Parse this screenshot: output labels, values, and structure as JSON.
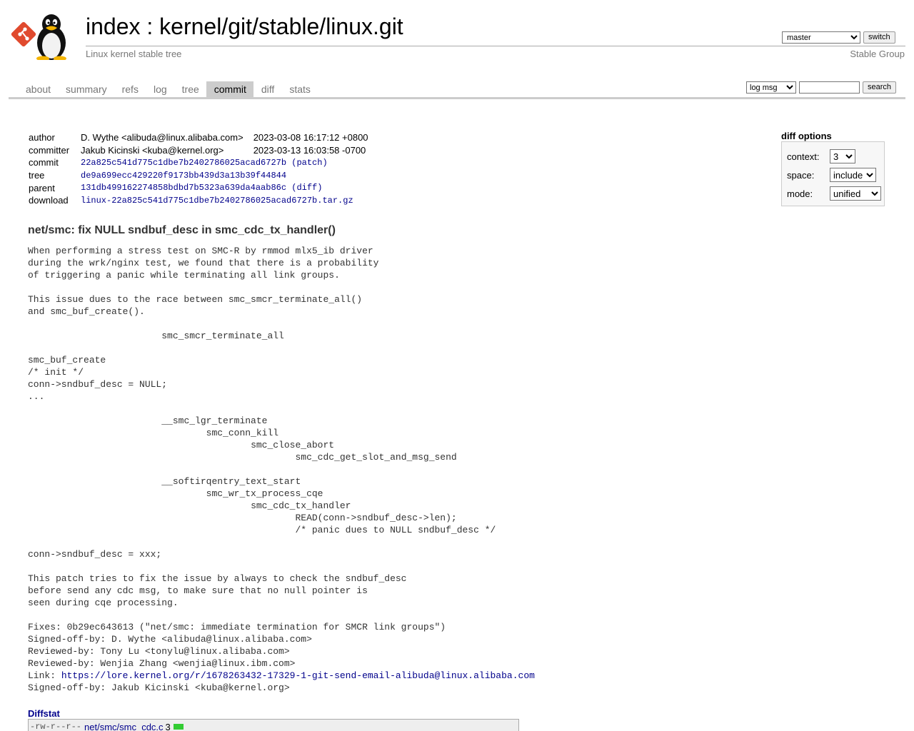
{
  "header": {
    "title_index": "index",
    "title_sep": " : ",
    "title_repo": "kernel/git/stable/linux.git",
    "description": "Linux kernel stable tree",
    "owner": "Stable Group",
    "branch_selected": "master",
    "switch_label": "switch"
  },
  "tabs": [
    {
      "label": "about",
      "active": false
    },
    {
      "label": "summary",
      "active": false
    },
    {
      "label": "refs",
      "active": false
    },
    {
      "label": "log",
      "active": false
    },
    {
      "label": "tree",
      "active": false
    },
    {
      "label": "commit",
      "active": true
    },
    {
      "label": "diff",
      "active": false
    },
    {
      "label": "stats",
      "active": false
    }
  ],
  "search": {
    "mode_selected": "log msg",
    "query": "",
    "button_label": "search"
  },
  "commit_info": {
    "author_label": "author",
    "author": "D. Wythe <alibuda@linux.alibaba.com>",
    "author_date": "2023-03-08 16:17:12 +0800",
    "committer_label": "committer",
    "committer": "Jakub Kicinski <kuba@kernel.org>",
    "committer_date": "2023-03-13 16:03:58 -0700",
    "commit_label": "commit",
    "commit_sha": "22a825c541d775c1dbe7b2402786025acad6727b",
    "patch_link": "patch",
    "tree_label": "tree",
    "tree_sha": "de9a699ecc429220f9173bb439d3a13b39f44844",
    "parent_label": "parent",
    "parent_sha": "131db499162274858bdbd7b5323a639da4aab86c",
    "diff_link": "diff",
    "download_label": "download",
    "download_file": "linux-22a825c541d775c1dbe7b2402786025acad6727b.tar.gz"
  },
  "diff_options": {
    "title": "diff options",
    "context_label": "context:",
    "context_value": "3",
    "space_label": "space:",
    "space_value": "include",
    "mode_label": "mode:",
    "mode_value": "unified"
  },
  "commit_subject": "net/smc: fix NULL sndbuf_desc in smc_cdc_tx_handler()",
  "commit_message_body": "When performing a stress test on SMC-R by rmmod mlx5_ib driver\nduring the wrk/nginx test, we found that there is a probability\nof triggering a panic while terminating all link groups.\n\nThis issue dues to the race between smc_smcr_terminate_all()\nand smc_buf_create().\n\n\t\t\tsmc_smcr_terminate_all\n\nsmc_buf_create\n/* init */\nconn->sndbuf_desc = NULL;\n...\n\n\t\t\t__smc_lgr_terminate\n\t\t\t\tsmc_conn_kill\n\t\t\t\t\tsmc_close_abort\n\t\t\t\t\t\tsmc_cdc_get_slot_and_msg_send\n\n\t\t\t__softirqentry_text_start\n\t\t\t\tsmc_wr_tx_process_cqe\n\t\t\t\t\tsmc_cdc_tx_handler\n\t\t\t\t\t\tREAD(conn->sndbuf_desc->len);\n\t\t\t\t\t\t/* panic dues to NULL sndbuf_desc */\n\nconn->sndbuf_desc = xxx;\n\nThis patch tries to fix the issue by always to check the sndbuf_desc\nbefore send any cdc msg, to make sure that no null pointer is\nseen during cqe processing.\n\nFixes: 0b29ec643613 (\"net/smc: immediate termination for SMCR link groups\")\nSigned-off-by: D. Wythe <alibuda@linux.alibaba.com>\nReviewed-by: Tony Lu <tonylu@linux.alibaba.com>\nReviewed-by: Wenjia Zhang <wenjia@linux.ibm.com>\n",
  "commit_message_link_prefix": "Link: ",
  "commit_message_link": "https://lore.kernel.org/r/1678263432-17329-1-git-send-email-alibuda@linux.alibaba.com",
  "commit_message_tail": "\nSigned-off-by: Jakub Kicinski <kuba@kernel.org>",
  "diffstat": {
    "header": "Diffstat",
    "rows": [
      {
        "mode": "-rw-r--r--",
        "file": "net/smc/smc_cdc.c",
        "count": "3"
      }
    ],
    "add_color": "#33cc33"
  },
  "colors": {
    "active_tab_bg": "#cccccc",
    "link": "#00008b",
    "muted": "#777777"
  }
}
